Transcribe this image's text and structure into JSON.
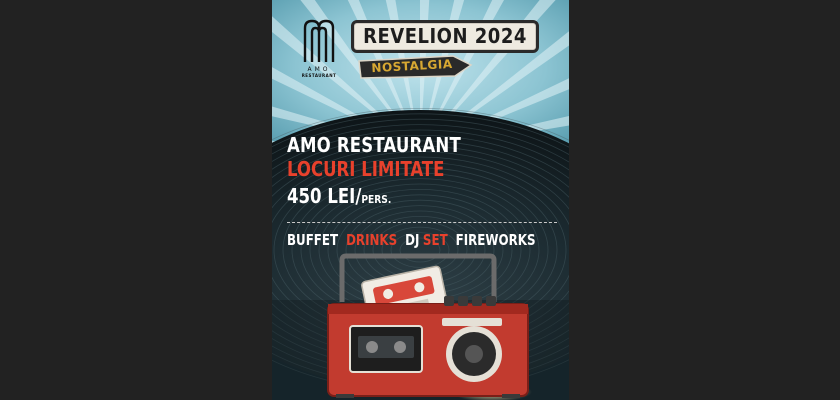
{
  "logo": {
    "name": "AMO",
    "sub": "RESTAURANT",
    "icon": "amo-monogram-logo"
  },
  "title": "REVELION 2024",
  "tag": "NOSTALGIA",
  "venue": "AMO RESTAURANT",
  "limited": "LOCURI LIMITATE",
  "price": {
    "amount": "450 LEI/",
    "unit": "PERS."
  },
  "features": {
    "buffet": "BUFFET",
    "drinks": "DRINKS",
    "dj": "DJ",
    "set": "SET",
    "fireworks": "FIREWORKS"
  },
  "colors": {
    "accent_red": "#e8412c",
    "tag_gold": "#d8a832",
    "sky_blue": "#8cc4d2",
    "dark_teal": "#1a2c33"
  },
  "illustration": {
    "icon": "retro-cassette-radio-icon"
  }
}
